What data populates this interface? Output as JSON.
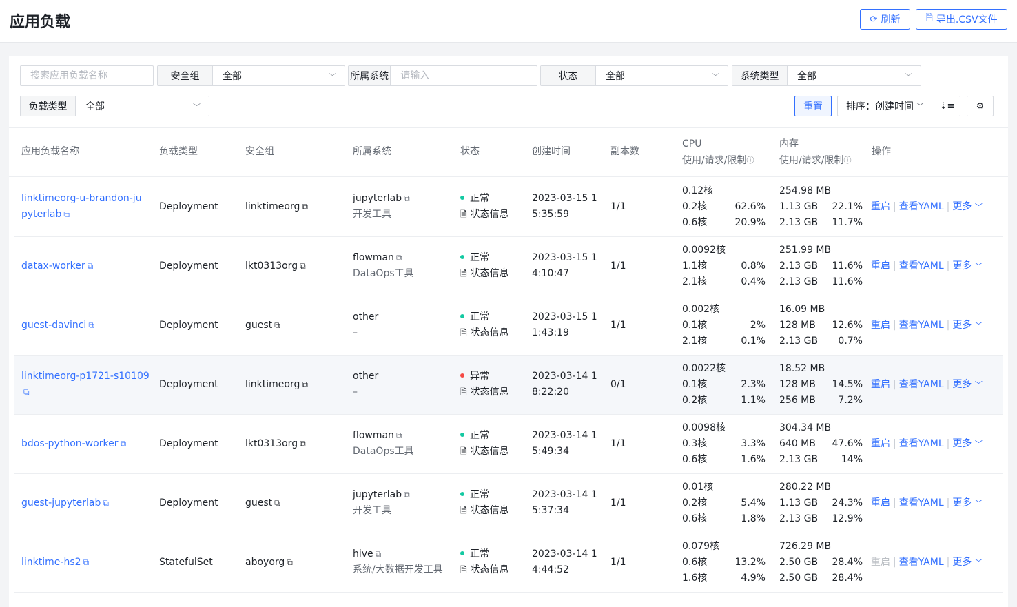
{
  "header": {
    "title": "应用负载",
    "refresh_label": "刷新",
    "export_label": "导出.CSV文件"
  },
  "filters": {
    "search_placeholder": "搜索应用负载名称",
    "security_group_label": "安全组",
    "security_group_value": "全部",
    "system_label": "所属系统",
    "system_placeholder": "请输入",
    "status_label": "状态",
    "status_value": "全部",
    "system_type_label": "系统类型",
    "system_type_value": "全部",
    "workload_type_label": "负载类型",
    "workload_type_value": "全部",
    "reset_label": "重置",
    "sort_label": "排序：创建时间"
  },
  "columns": {
    "name": "应用负载名称",
    "type": "负载类型",
    "security_group": "安全组",
    "system": "所属系统",
    "status": "状态",
    "created": "创建时间",
    "replicas": "副本数",
    "cpu": "CPU",
    "cpu_sub": "使用/请求/限制",
    "mem": "内存",
    "mem_sub": "使用/请求/限制",
    "actions": "操作"
  },
  "rows": [
    {
      "name1": "linktimeorg-u-brandon-ju",
      "name2": "pyterlab",
      "type": "Deployment",
      "group": "linktimeorg",
      "system": "jupyterlab",
      "system_link": true,
      "system_type": "开发工具",
      "status": "正常",
      "status_ok": true,
      "status_info": "状态信息",
      "created1": "2023-03-15 1",
      "created2": "5:35:59",
      "replicas": "1/1",
      "cpu_use": "0.12核",
      "cpu_req": "0.2核",
      "cpu_req_pct": "62.6%",
      "cpu_lim": "0.6核",
      "cpu_lim_pct": "20.9%",
      "mem_use": "254.98 MB",
      "mem_req": "1.13 GB",
      "mem_req_pct": "22.1%",
      "mem_lim": "2.13 GB",
      "mem_lim_pct": "11.7%",
      "restart": "重启",
      "restart_disabled": false,
      "yaml": "查看YAML",
      "more": "更多"
    },
    {
      "name1": "datax-worker",
      "name2": "",
      "type": "Deployment",
      "group": "lkt0313org",
      "system": "flowman",
      "system_link": true,
      "system_type": "DataOps工具",
      "status": "正常",
      "status_ok": true,
      "status_info": "状态信息",
      "created1": "2023-03-15 1",
      "created2": "4:10:47",
      "replicas": "1/1",
      "cpu_use": "0.0092核",
      "cpu_req": "1.1核",
      "cpu_req_pct": "0.8%",
      "cpu_lim": "2.1核",
      "cpu_lim_pct": "0.4%",
      "mem_use": "251.99 MB",
      "mem_req": "2.13 GB",
      "mem_req_pct": "11.6%",
      "mem_lim": "2.13 GB",
      "mem_lim_pct": "11.6%",
      "restart": "重启",
      "restart_disabled": false,
      "yaml": "查看YAML",
      "more": "更多"
    },
    {
      "name1": "guest-davinci",
      "name2": "",
      "type": "Deployment",
      "group": "guest",
      "system": "other",
      "system_link": false,
      "system_type": "–",
      "status": "正常",
      "status_ok": true,
      "status_info": "状态信息",
      "created1": "2023-03-15 1",
      "created2": "1:43:19",
      "replicas": "1/1",
      "cpu_use": "0.002核",
      "cpu_req": "0.1核",
      "cpu_req_pct": "2%",
      "cpu_lim": "2.1核",
      "cpu_lim_pct": "0.1%",
      "mem_use": "16.09 MB",
      "mem_req": "128 MB",
      "mem_req_pct": "12.6%",
      "mem_lim": "2.13 GB",
      "mem_lim_pct": "0.7%",
      "restart": "重启",
      "restart_disabled": false,
      "yaml": "查看YAML",
      "more": "更多"
    },
    {
      "name1": "linktimeorg-p1721-s10109",
      "name2": "",
      "type": "Deployment",
      "group": "linktimeorg",
      "system": "other",
      "system_link": false,
      "system_type": "–",
      "status": "异常",
      "status_ok": false,
      "status_info": "状态信息",
      "created1": "2023-03-14 1",
      "created2": "8:22:20",
      "replicas": "0/1",
      "cpu_use": "0.0022核",
      "cpu_req": "0.1核",
      "cpu_req_pct": "2.3%",
      "cpu_lim": "0.2核",
      "cpu_lim_pct": "1.1%",
      "mem_use": "18.52 MB",
      "mem_req": "128 MB",
      "mem_req_pct": "14.5%",
      "mem_lim": "256 MB",
      "mem_lim_pct": "7.2%",
      "restart": "重启",
      "restart_disabled": false,
      "yaml": "查看YAML",
      "more": "更多"
    },
    {
      "name1": "bdos-python-worker",
      "name2": "",
      "type": "Deployment",
      "group": "lkt0313org",
      "system": "flowman",
      "system_link": true,
      "system_type": "DataOps工具",
      "status": "正常",
      "status_ok": true,
      "status_info": "状态信息",
      "created1": "2023-03-14 1",
      "created2": "5:49:34",
      "replicas": "1/1",
      "cpu_use": "0.0098核",
      "cpu_req": "0.3核",
      "cpu_req_pct": "3.3%",
      "cpu_lim": "0.6核",
      "cpu_lim_pct": "1.6%",
      "mem_use": "304.34 MB",
      "mem_req": "640 MB",
      "mem_req_pct": "47.6%",
      "mem_lim": "2.13 GB",
      "mem_lim_pct": "14%",
      "restart": "重启",
      "restart_disabled": false,
      "yaml": "查看YAML",
      "more": "更多"
    },
    {
      "name1": "guest-jupyterlab",
      "name2": "",
      "type": "Deployment",
      "group": "guest",
      "system": "jupyterlab",
      "system_link": true,
      "system_type": "开发工具",
      "status": "正常",
      "status_ok": true,
      "status_info": "状态信息",
      "created1": "2023-03-14 1",
      "created2": "5:37:34",
      "replicas": "1/1",
      "cpu_use": "0.01核",
      "cpu_req": "0.2核",
      "cpu_req_pct": "5.4%",
      "cpu_lim": "0.6核",
      "cpu_lim_pct": "1.8%",
      "mem_use": "280.22 MB",
      "mem_req": "1.13 GB",
      "mem_req_pct": "24.3%",
      "mem_lim": "2.13 GB",
      "mem_lim_pct": "12.9%",
      "restart": "重启",
      "restart_disabled": false,
      "yaml": "查看YAML",
      "more": "更多"
    },
    {
      "name1": "linktime-hs2",
      "name2": "",
      "type": "StatefulSet",
      "group": "aboyorg",
      "system": "hive",
      "system_link": true,
      "system_type": "系统/大数据开发工具",
      "status": "正常",
      "status_ok": true,
      "status_info": "状态信息",
      "created1": "2023-03-14 1",
      "created2": "4:44:52",
      "replicas": "1/1",
      "cpu_use": "0.079核",
      "cpu_req": "0.6核",
      "cpu_req_pct": "13.2%",
      "cpu_lim": "1.6核",
      "cpu_lim_pct": "4.9%",
      "mem_use": "726.29 MB",
      "mem_req": "2.50 GB",
      "mem_req_pct": "28.4%",
      "mem_lim": "2.50 GB",
      "mem_lim_pct": "28.4%",
      "restart": "重启",
      "restart_disabled": true,
      "yaml": "查看YAML",
      "more": "更多"
    }
  ],
  "colors": {
    "accent": "#3370ff",
    "ok": "#14c9a2",
    "error": "#f54a45"
  }
}
